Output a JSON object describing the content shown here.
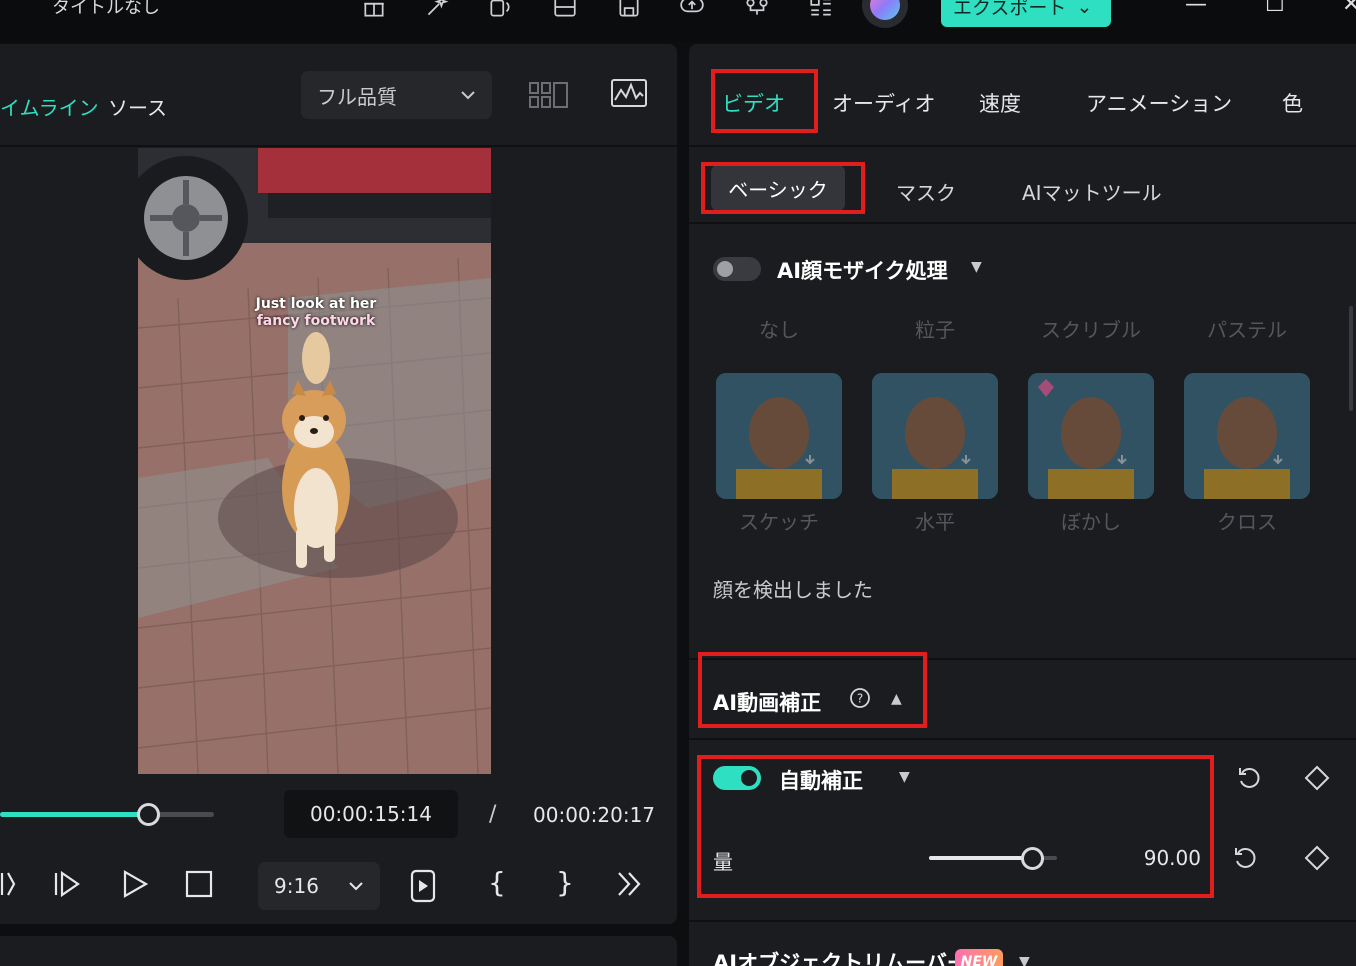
{
  "window": {
    "title": "タイトルなし",
    "export_label": "エクスポート",
    "toolbar_icons": [
      "gift-icon",
      "magic-star-icon",
      "clipboard-audio-icon",
      "layout-icon",
      "save-icon",
      "cloud-upload-icon",
      "network-icon",
      "grid-apps-icon"
    ],
    "window_controls": [
      "minimize-icon",
      "maximize-icon",
      "close-icon"
    ]
  },
  "preview": {
    "tabs": [
      "イムライン",
      "ソース"
    ],
    "active_tab": "イムライン",
    "quality": "フル品質",
    "video_caption_line1": "Just look at her",
    "video_caption_line2": "fancy footwork",
    "progress": 0.69,
    "current_time": "00:00:15:14",
    "time_separator": "/",
    "total_time": "00:00:20:17",
    "aspect_ratio": "9:16",
    "bracket_in": "{",
    "bracket_out": "}"
  },
  "properties": {
    "main_tabs": [
      "ビデオ",
      "オーディオ",
      "速度",
      "アニメーション",
      "色"
    ],
    "active_main_tab": "ビデオ",
    "sub_tabs": [
      "ベーシック",
      "マスク",
      "AIマットツール"
    ],
    "active_sub_tab": "ベーシック",
    "face_mosaic": {
      "title": "AI顔モザイク処理",
      "enabled": false,
      "top_labels": [
        "なし",
        "粒子",
        "スクリブル",
        "パステル"
      ],
      "styles": [
        "スケッチ",
        "水平",
        "ぼかし",
        "クロス"
      ],
      "status": "顔を検出しました"
    },
    "ai_video_enhance": {
      "title": "AI動画補正",
      "auto_enhance_label": "自動補正",
      "auto_enhance_enabled": true,
      "amount_label": "量",
      "amount_value": "90.00",
      "amount_fraction": 0.9
    },
    "object_remover": {
      "title": "AIオブジェクトリムーバー",
      "badge": "NEW"
    }
  },
  "colors": {
    "accent": "#2ee0c1",
    "highlight_box": "#e21d1d",
    "panel_bg": "#1b1c1f"
  }
}
